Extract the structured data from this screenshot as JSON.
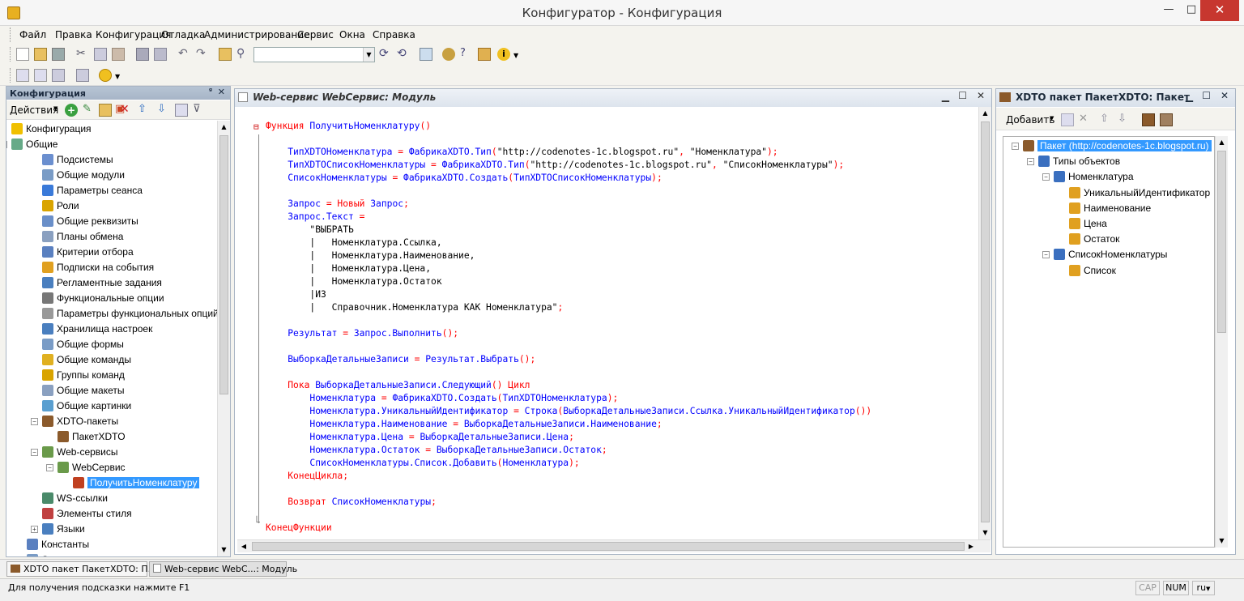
{
  "window": {
    "title": "Конфигуратор - Конфигурация",
    "close_glyph": "✕",
    "max_glyph": "□",
    "min_glyph": "—"
  },
  "menu": [
    "Файл",
    "Правка",
    "Конфигурация",
    "Отладка",
    "Администрирование",
    "Сервис",
    "Окна",
    "Справка"
  ],
  "left_panel": {
    "title": "Конфигурация",
    "actions_label": "Действия",
    "tree": [
      {
        "label": "Конфигурация",
        "level": 0,
        "icon": "config-icon",
        "color": "#f0c000"
      },
      {
        "label": "Общие",
        "level": 0,
        "icon": "common-icon",
        "color": "#6a8",
        "expander": "⊖"
      },
      {
        "label": "Подсистемы",
        "level": 2,
        "icon": "subsystems-icon",
        "color": "#6b8fcf"
      },
      {
        "label": "Общие модули",
        "level": 2,
        "icon": "modules-icon",
        "color": "#7a9cc6"
      },
      {
        "label": "Параметры сеанса",
        "level": 2,
        "icon": "session-params-icon",
        "color": "#3a7ad9"
      },
      {
        "label": "Роли",
        "level": 2,
        "icon": "roles-icon",
        "color": "#d9a400"
      },
      {
        "label": "Общие реквизиты",
        "level": 2,
        "icon": "common-attributes-icon",
        "color": "#6a8fc9"
      },
      {
        "label": "Планы обмена",
        "level": 2,
        "icon": "exchange-plans-icon",
        "color": "#8aa0c0"
      },
      {
        "label": "Критерии отбора",
        "level": 2,
        "icon": "filter-criteria-icon",
        "color": "#5a80c0"
      },
      {
        "label": "Подписки на события",
        "level": 2,
        "icon": "event-subscriptions-icon",
        "color": "#e0a020"
      },
      {
        "label": "Регламентные задания",
        "level": 2,
        "icon": "scheduled-jobs-icon",
        "color": "#4a7fbf"
      },
      {
        "label": "Функциональные опции",
        "level": 2,
        "icon": "functional-options-icon",
        "color": "#777"
      },
      {
        "label": "Параметры функциональных опций",
        "level": 2,
        "icon": "fo-params-icon",
        "color": "#999"
      },
      {
        "label": "Хранилища настроек",
        "level": 2,
        "icon": "settings-storage-icon",
        "color": "#4a7fbf"
      },
      {
        "label": "Общие формы",
        "level": 2,
        "icon": "common-forms-icon",
        "color": "#7a9cc6"
      },
      {
        "label": "Общие команды",
        "level": 2,
        "icon": "common-commands-icon",
        "color": "#e0b020"
      },
      {
        "label": "Группы команд",
        "level": 2,
        "icon": "command-groups-icon",
        "color": "#d9a400"
      },
      {
        "label": "Общие макеты",
        "level": 2,
        "icon": "common-templates-icon",
        "color": "#8aa0c0"
      },
      {
        "label": "Общие картинки",
        "level": 2,
        "icon": "common-pictures-icon",
        "color": "#5a9fd0"
      },
      {
        "label": "XDTO-пакеты",
        "level": 2,
        "icon": "xdto-packages-icon",
        "color": "#8b5a2b",
        "expander": "⊖"
      },
      {
        "label": "ПакетXDTO",
        "level": 3,
        "icon": "xdto-package-icon",
        "color": "#8b5a2b"
      },
      {
        "label": "Web-сервисы",
        "level": 2,
        "icon": "web-services-icon",
        "color": "#6a9a4a",
        "expander": "⊖"
      },
      {
        "label": "WebСервис",
        "level": 3,
        "icon": "web-service-icon",
        "color": "#6a9a4a",
        "expander": "⊖"
      },
      {
        "label": "ПолучитьНоменклатуру",
        "level": 4,
        "icon": "operation-icon",
        "color": "#c04020",
        "selected": true
      },
      {
        "label": "WS-ссылки",
        "level": 2,
        "icon": "ws-links-icon",
        "color": "#4a8a6a"
      },
      {
        "label": "Элементы стиля",
        "level": 2,
        "icon": "style-items-icon",
        "color": "#c04040"
      },
      {
        "label": "Языки",
        "level": 2,
        "icon": "languages-icon",
        "color": "#4a7fbf",
        "expander": "⊕"
      },
      {
        "label": "Константы",
        "level": 1,
        "icon": "constants-icon",
        "color": "#5a80c0"
      },
      {
        "label": "Справочники",
        "level": 1,
        "icon": "catalogs-icon",
        "color": "#7a9cc6",
        "expander": "⊕"
      }
    ]
  },
  "editor": {
    "title": "Web-сервис WebСервис: Модуль",
    "fold_open": "⊟",
    "fold_end": "└",
    "lines": [
      [
        [
          "kw",
          "Функция "
        ],
        [
          "id",
          "ПолучитьНоменклатуру"
        ],
        [
          "kw",
          "()"
        ]
      ],
      [],
      [
        [
          "id",
          "    ТипXDTOНоменклатура "
        ],
        [
          "kw",
          "= "
        ],
        [
          "id",
          "ФабрикаXDTO.Тип"
        ],
        [
          "kw",
          "("
        ],
        [
          "str",
          "\"http://codenotes-1c.blogspot.ru\""
        ],
        [
          "kw",
          ", "
        ],
        [
          "str",
          "\"Номенклатура\""
        ],
        [
          "kw",
          ");"
        ]
      ],
      [
        [
          "id",
          "    ТипXDTOСписокНоменклатуры "
        ],
        [
          "kw",
          "= "
        ],
        [
          "id",
          "ФабрикаXDTO.Тип"
        ],
        [
          "kw",
          "("
        ],
        [
          "str",
          "\"http://codenotes-1c.blogspot.ru\""
        ],
        [
          "kw",
          ", "
        ],
        [
          "str",
          "\"СписокНоменклатуры\""
        ],
        [
          "kw",
          ");"
        ]
      ],
      [
        [
          "id",
          "    СписокНоменклатуры "
        ],
        [
          "kw",
          "= "
        ],
        [
          "id",
          "ФабрикаXDTO.Создать"
        ],
        [
          "kw",
          "("
        ],
        [
          "id",
          "ТипXDTOСписокНоменклатуры"
        ],
        [
          "kw",
          ");"
        ]
      ],
      [],
      [
        [
          "id",
          "    Запрос "
        ],
        [
          "kw",
          "= Новый "
        ],
        [
          "id",
          "Запрос"
        ],
        [
          "kw",
          ";"
        ]
      ],
      [
        [
          "id",
          "    Запрос.Текст "
        ],
        [
          "kw",
          "="
        ]
      ],
      [
        [
          "str",
          "        \"ВЫБРАТЬ"
        ]
      ],
      [
        [
          "str",
          "        |   Номенклатура.Ссылка,"
        ]
      ],
      [
        [
          "str",
          "        |   Номенклатура.Наименование,"
        ]
      ],
      [
        [
          "str",
          "        |   Номенклатура.Цена,"
        ]
      ],
      [
        [
          "str",
          "        |   Номенклатура.Остаток"
        ]
      ],
      [
        [
          "str",
          "        |ИЗ"
        ]
      ],
      [
        [
          "str",
          "        |   Справочник.Номенклатура КАК Номенклатура\""
        ],
        [
          "kw",
          ";"
        ]
      ],
      [],
      [
        [
          "id",
          "    Результат "
        ],
        [
          "kw",
          "= "
        ],
        [
          "id",
          "Запрос.Выполнить"
        ],
        [
          "kw",
          "();"
        ]
      ],
      [],
      [
        [
          "id",
          "    ВыборкаДетальныеЗаписи "
        ],
        [
          "kw",
          "= "
        ],
        [
          "id",
          "Результат.Выбрать"
        ],
        [
          "kw",
          "();"
        ]
      ],
      [],
      [
        [
          "kw",
          "    Пока "
        ],
        [
          "id",
          "ВыборкаДетальныеЗаписи.Следующий"
        ],
        [
          "kw",
          "() Цикл"
        ]
      ],
      [
        [
          "id",
          "        Номенклатура "
        ],
        [
          "kw",
          "= "
        ],
        [
          "id",
          "ФабрикаXDTO.Создать"
        ],
        [
          "kw",
          "("
        ],
        [
          "id",
          "ТипXDTOНоменклатура"
        ],
        [
          "kw",
          ");"
        ]
      ],
      [
        [
          "id",
          "        Номенклатура.УникальныйИдентификатор "
        ],
        [
          "kw",
          "= "
        ],
        [
          "id",
          "Строка"
        ],
        [
          "kw",
          "("
        ],
        [
          "id",
          "ВыборкаДетальныеЗаписи.Ссылка.УникальныйИдентификатор"
        ],
        [
          "kw",
          "())"
        ]
      ],
      [
        [
          "id",
          "        Номенклатура.Наименование "
        ],
        [
          "kw",
          "= "
        ],
        [
          "id",
          "ВыборкаДетальныеЗаписи.Наименование"
        ],
        [
          "kw",
          ";"
        ]
      ],
      [
        [
          "id",
          "        Номенклатура.Цена "
        ],
        [
          "kw",
          "= "
        ],
        [
          "id",
          "ВыборкаДетальныеЗаписи.Цена"
        ],
        [
          "kw",
          ";"
        ]
      ],
      [
        [
          "id",
          "        Номенклатура.Остаток "
        ],
        [
          "kw",
          "= "
        ],
        [
          "id",
          "ВыборкаДетальныеЗаписи.Остаток"
        ],
        [
          "kw",
          ";"
        ]
      ],
      [
        [
          "id",
          "        СписокНоменклатуры.Список.Добавить"
        ],
        [
          "kw",
          "("
        ],
        [
          "id",
          "Номенклатура"
        ],
        [
          "kw",
          ");"
        ]
      ],
      [
        [
          "kw",
          "    КонецЦикла;"
        ]
      ],
      [],
      [
        [
          "kw",
          "    Возврат "
        ],
        [
          "id",
          "СписокНоменклатуры"
        ],
        [
          "kw",
          ";"
        ]
      ],
      [],
      [
        [
          "kw",
          "КонецФункции"
        ]
      ]
    ]
  },
  "right_panel": {
    "title": "XDTO пакет ПакетXDTO: Пакет",
    "add_label": "Добавить",
    "tree": [
      {
        "label": "Пакет (http://codenotes-1c.blogspot.ru)",
        "level": 0,
        "icon": "package-icon",
        "color": "#8b5a2b",
        "expander": "⊖",
        "selected": true
      },
      {
        "label": "Типы объектов",
        "level": 1,
        "icon": "object-types-icon",
        "color": "#3a6fbf",
        "expander": "⊖"
      },
      {
        "label": "Номенклатура",
        "level": 2,
        "icon": "object-type-icon",
        "color": "#3a6fbf",
        "expander": "⊖"
      },
      {
        "label": "УникальныйИдентификатор",
        "level": 3,
        "icon": "property-icon",
        "color": "#e0a020"
      },
      {
        "label": "Наименование",
        "level": 3,
        "icon": "property-icon",
        "color": "#e0a020"
      },
      {
        "label": "Цена",
        "level": 3,
        "icon": "property-icon",
        "color": "#e0a020"
      },
      {
        "label": "Остаток",
        "level": 3,
        "icon": "property-icon",
        "color": "#e0a020"
      },
      {
        "label": "СписокНоменклатуры",
        "level": 2,
        "icon": "object-type-icon",
        "color": "#3a6fbf",
        "expander": "⊖"
      },
      {
        "label": "Список",
        "level": 3,
        "icon": "property-icon",
        "color": "#e0a020"
      }
    ]
  },
  "tabs": [
    {
      "label": "XDTO пакет ПакетXDTO: П..."
    },
    {
      "label": "Web-сервис WebС...: Модуль"
    }
  ],
  "status": {
    "hint": "Для получения подсказки нажмите F1",
    "cap": "CAP",
    "num": "NUM",
    "lang": "ru"
  }
}
